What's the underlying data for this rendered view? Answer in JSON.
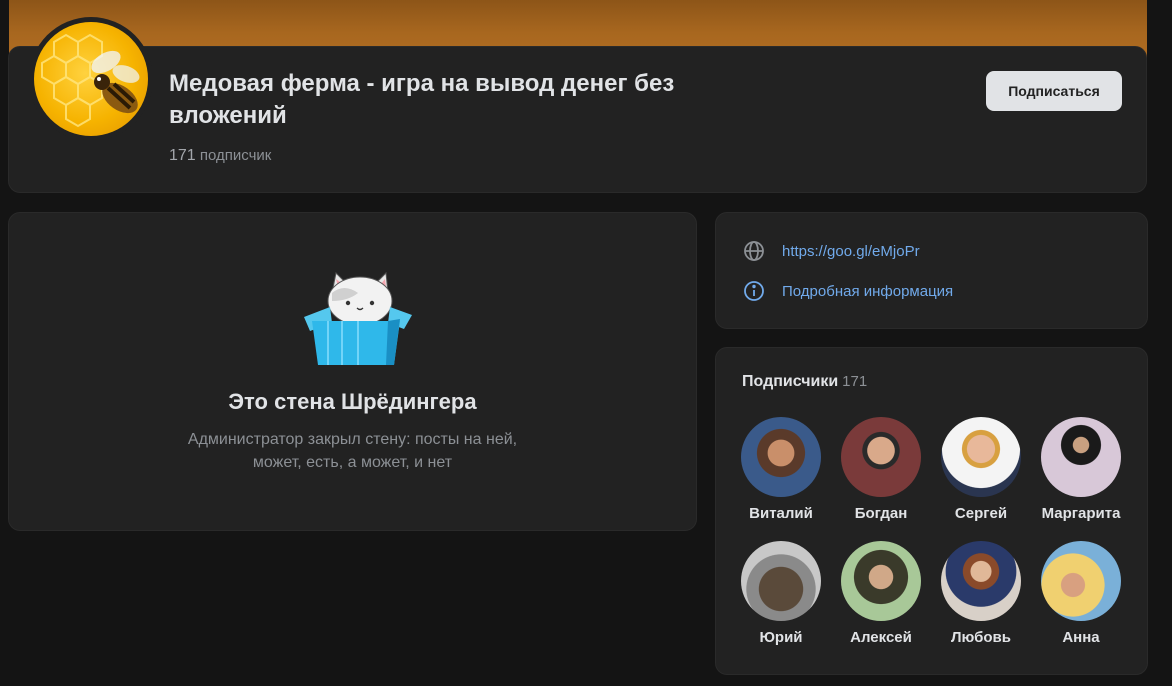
{
  "group": {
    "title": "Медовая ферма - игра на вывод денег без вложений",
    "subscriber_count": "171",
    "subscriber_word": "подписчик",
    "subscribe_label": "Подписаться",
    "avatar_icon": "honeycomb-bee-icon"
  },
  "wall": {
    "title": "Это стена Шрёдингера",
    "text": "Администратор закрыл стену: посты на ней,\nможет, есть, а может, и нет",
    "illustration_icon": "cat-in-box-icon"
  },
  "links": {
    "website": "https://goo.gl/eMjoPr",
    "details": "Подробная информация"
  },
  "subscribers": {
    "title": "Подписчики",
    "count": "171",
    "members": [
      {
        "name": "Виталий"
      },
      {
        "name": "Богдан"
      },
      {
        "name": "Сергей"
      },
      {
        "name": "Маргарита"
      },
      {
        "name": "Юрий"
      },
      {
        "name": "Алексей"
      },
      {
        "name": "Любовь"
      },
      {
        "name": "Анна"
      }
    ]
  },
  "colors": {
    "background": "#141414",
    "card": "#222222",
    "accent_link": "#71aaeb",
    "button_bg": "#e1e3e6",
    "cover": "#a8671f"
  }
}
